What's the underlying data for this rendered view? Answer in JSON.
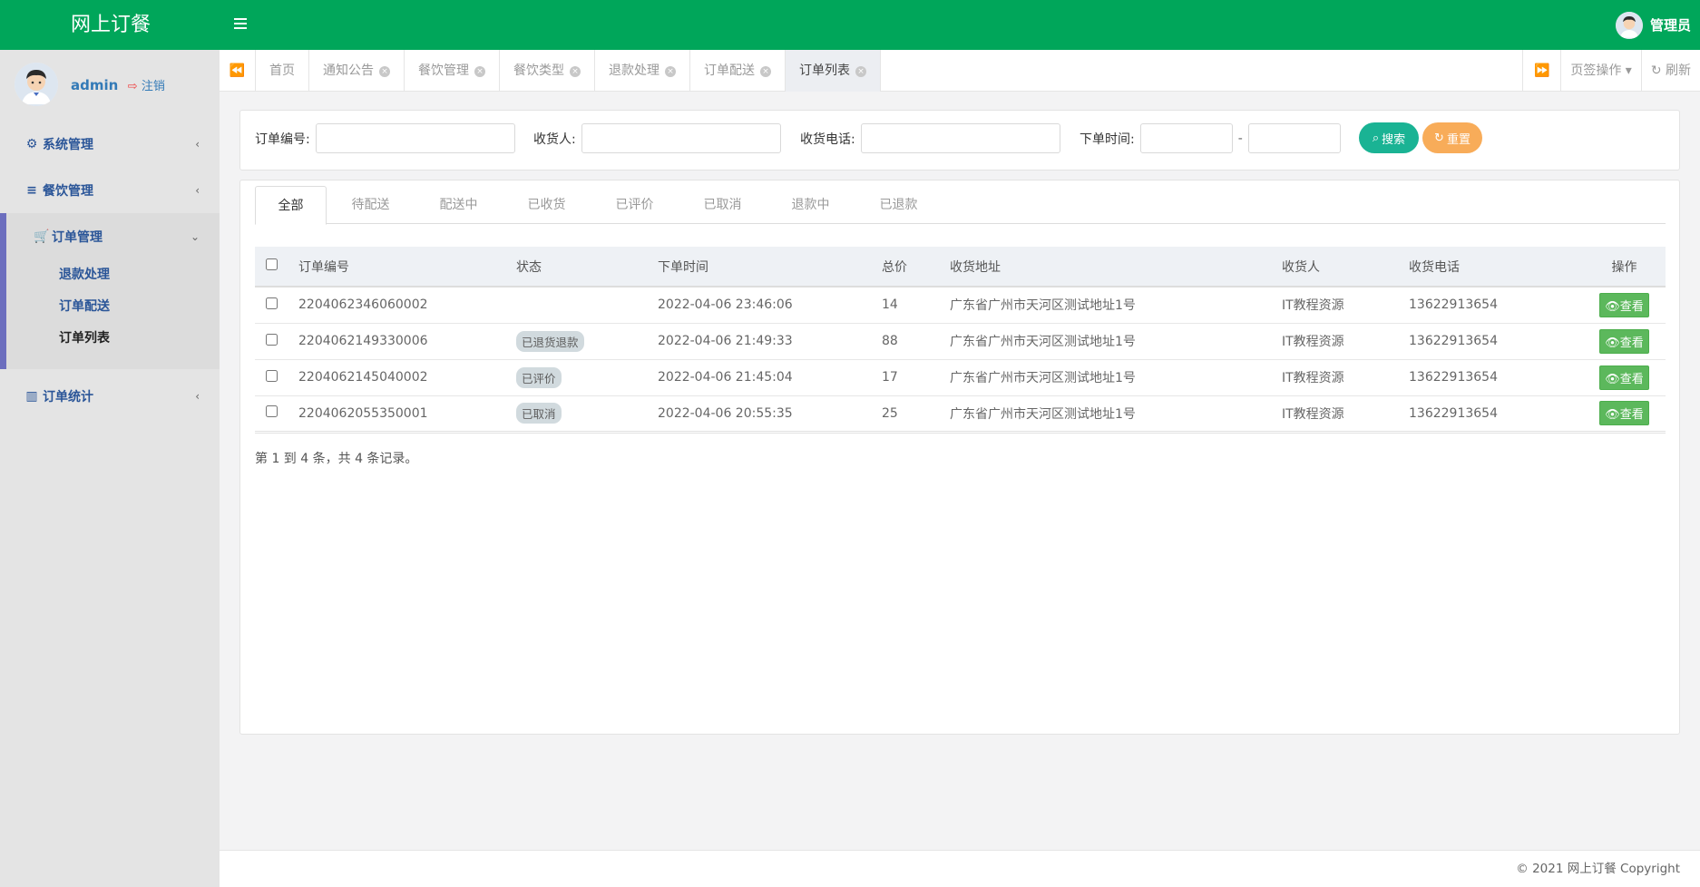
{
  "app": {
    "title": "网上订餐"
  },
  "topbar": {
    "user_label": "管理员"
  },
  "sidebar": {
    "username": "admin",
    "logout_label": "注销",
    "menu": {
      "system": "系统管理",
      "catering": "餐饮管理",
      "orders": "订单管理",
      "stats": "订单统计"
    },
    "submenu": [
      "退款处理",
      "订单配送",
      "订单列表"
    ]
  },
  "tabs": [
    "首页",
    "通知公告",
    "餐饮管理",
    "餐饮类型",
    "退款处理",
    "订单配送",
    "订单列表"
  ],
  "tabbar": {
    "page_ops": "页签操作",
    "refresh": "刷新"
  },
  "search": {
    "order_no_label": "订单编号:",
    "receiver_label": "收货人:",
    "phone_label": "收货电话:",
    "time_label": "下单时间:",
    "time_sep": "-",
    "search_btn": "搜索",
    "reset_btn": "重置"
  },
  "status_tabs": [
    "全部",
    "待配送",
    "配送中",
    "已收货",
    "已评价",
    "已取消",
    "退款中",
    "已退款"
  ],
  "table": {
    "headers": [
      "订单编号",
      "状态",
      "下单时间",
      "总价",
      "收货地址",
      "收货人",
      "收货电话",
      "操作"
    ],
    "view_label": "查看",
    "rows": [
      {
        "order_no": "2204062346060002",
        "status": "",
        "time": "2022-04-06 23:46:06",
        "total": "14",
        "address": "广东省广州市天河区测试地址1号",
        "receiver": "IT教程资源",
        "phone": "13622913654"
      },
      {
        "order_no": "2204062149330006",
        "status": "已退货退款",
        "time": "2022-04-06 21:49:33",
        "total": "88",
        "address": "广东省广州市天河区测试地址1号",
        "receiver": "IT教程资源",
        "phone": "13622913654"
      },
      {
        "order_no": "2204062145040002",
        "status": "已评价",
        "time": "2022-04-06 21:45:04",
        "total": "17",
        "address": "广东省广州市天河区测试地址1号",
        "receiver": "IT教程资源",
        "phone": "13622913654"
      },
      {
        "order_no": "2204062055350001",
        "status": "已取消",
        "time": "2022-04-06 20:55:35",
        "total": "25",
        "address": "广东省广州市天河区测试地址1号",
        "receiver": "IT教程资源",
        "phone": "13622913654"
      }
    ]
  },
  "pager": "第 1 到 4 条，共 4 条记录。",
  "footer": "© 2021 网上订餐 Copyright",
  "colors": {
    "brand": "#00a65a",
    "search_btn": "#1ab394",
    "reset_btn": "#f8ac59",
    "view_btn": "#5cb85c",
    "menu_accent": "#6c6ebe"
  }
}
